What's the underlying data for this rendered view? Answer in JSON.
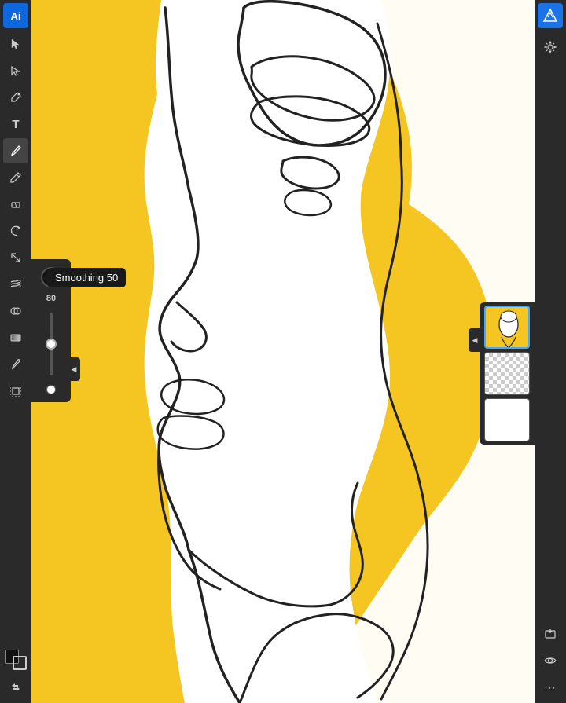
{
  "app": {
    "logo_letter": "Ai",
    "background_color": "#f5c522"
  },
  "tooltip": {
    "label": "Smoothing 50"
  },
  "brush_panel": {
    "size_value": "80",
    "smoothing_value": 50
  },
  "left_toolbar": {
    "tools": [
      {
        "name": "selection-tool",
        "icon": "◻",
        "active": false
      },
      {
        "name": "direct-selection-tool",
        "icon": "↖",
        "active": false
      },
      {
        "name": "pen-tool",
        "icon": "✒",
        "active": false
      },
      {
        "name": "type-tool",
        "icon": "T",
        "active": false
      },
      {
        "name": "brush-tool",
        "icon": "✏",
        "active": true
      },
      {
        "name": "pencil-tool",
        "icon": "✏",
        "active": false
      },
      {
        "name": "eraser-tool",
        "icon": "◻",
        "active": false
      },
      {
        "name": "rotate-tool",
        "icon": "↻",
        "active": false
      },
      {
        "name": "scale-tool",
        "icon": "⇲",
        "active": false
      },
      {
        "name": "warp-tool",
        "icon": "≋",
        "active": false
      },
      {
        "name": "shape-builder-tool",
        "icon": "⊕",
        "active": false
      },
      {
        "name": "gradient-tool",
        "icon": "▥",
        "active": false
      },
      {
        "name": "eyedropper-tool",
        "icon": "✧",
        "active": false
      },
      {
        "name": "artboard-tool",
        "icon": "⊞",
        "active": false
      },
      {
        "name": "color-swatch",
        "icon": "■",
        "active": false
      },
      {
        "name": "stroke-swatch",
        "icon": "□",
        "active": false
      },
      {
        "name": "swap-colors",
        "icon": "⇄",
        "active": false
      }
    ]
  },
  "right_toolbar": {
    "tools": [
      {
        "name": "settings-icon",
        "icon": "⚙",
        "active": false
      },
      {
        "name": "add-layer-icon",
        "icon": "+",
        "active": false
      },
      {
        "name": "eye-icon",
        "icon": "👁",
        "active": false
      },
      {
        "name": "more-options-icon",
        "icon": "•••",
        "active": false
      }
    ]
  },
  "layers": [
    {
      "name": "layer-1-thumb",
      "type": "drawing",
      "active": true
    },
    {
      "name": "layer-2-thumb",
      "type": "transparent",
      "active": false
    },
    {
      "name": "layer-3-thumb",
      "type": "empty",
      "active": false
    }
  ]
}
